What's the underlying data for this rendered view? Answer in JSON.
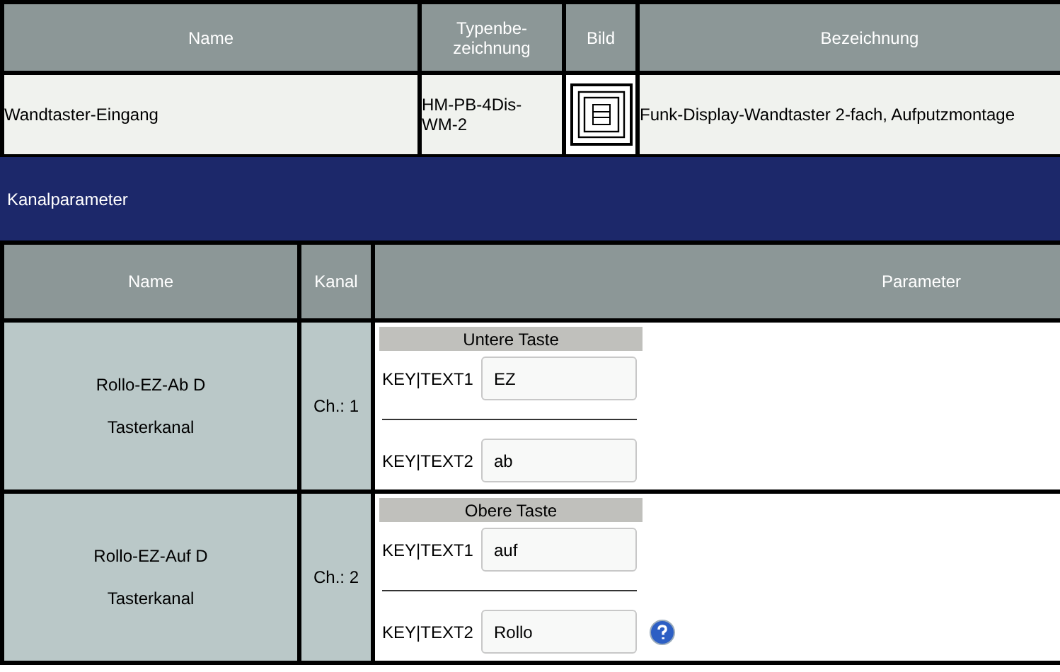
{
  "device_table": {
    "columns": [
      "Name",
      "Typenbe-\nzeichnung",
      "Bild",
      "Bezeichnung"
    ],
    "row": {
      "name": "Wandtaster-Eingang",
      "type": "HM-PB-4Dis-\nWM-2",
      "description": "Funk-Display-Wandtaster 2-fach, Aufputzmontage"
    }
  },
  "section_title": "Kanalparameter",
  "channel_table": {
    "columns": [
      "Name",
      "Kanal",
      "Parameter"
    ],
    "rows": [
      {
        "name": "Rollo-EZ-Ab D",
        "type": "Tasterkanal",
        "channel": "Ch.: 1",
        "group": "Untere Taste",
        "params": [
          {
            "label": "KEY|TEXT1",
            "value": "EZ"
          },
          {
            "label": "KEY|TEXT2",
            "value": "ab"
          }
        ],
        "help": false
      },
      {
        "name": "Rollo-EZ-Auf D",
        "type": "Tasterkanal",
        "channel": "Ch.: 2",
        "group": "Obere Taste",
        "params": [
          {
            "label": "KEY|TEXT1",
            "value": "auf"
          },
          {
            "label": "KEY|TEXT2",
            "value": "Rollo"
          }
        ],
        "help": true
      }
    ]
  }
}
